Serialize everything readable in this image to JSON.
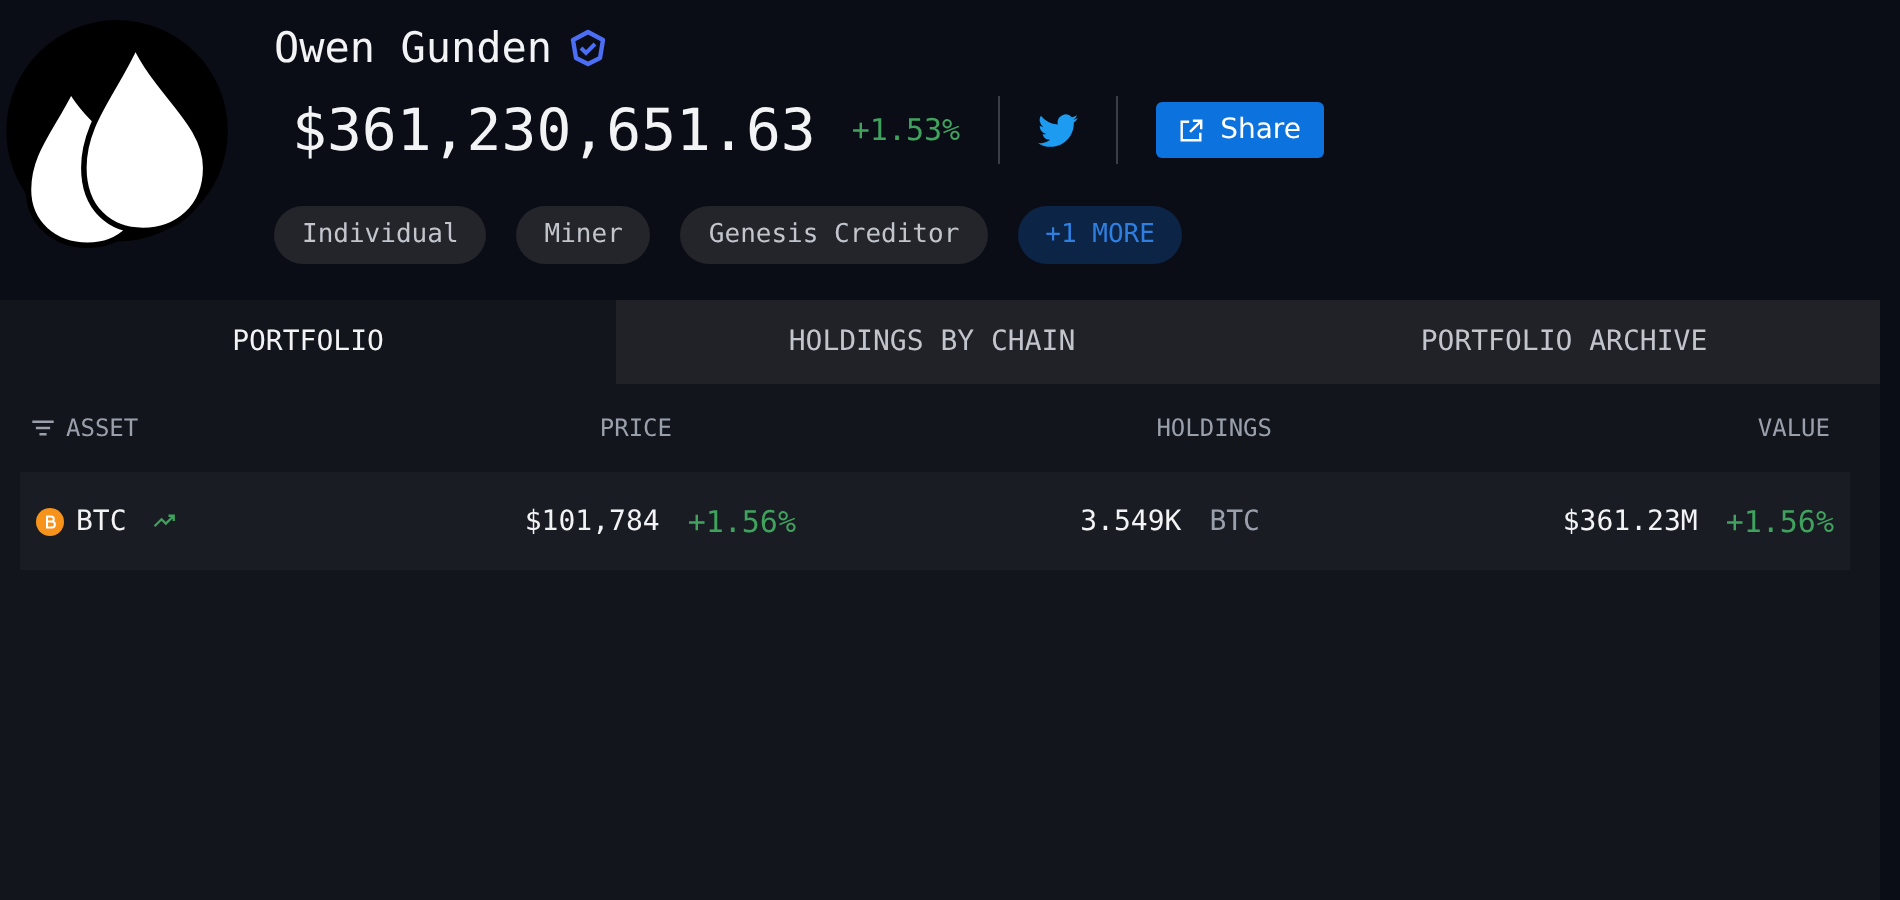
{
  "profile": {
    "name": "Owen Gunden",
    "verified": true,
    "balance": "$361,230,651.63",
    "change": "+1.53%",
    "share_label": "Share",
    "tags": [
      {
        "label": "Individual",
        "kind": "tag"
      },
      {
        "label": "Miner",
        "kind": "tag"
      },
      {
        "label": "Genesis Creditor",
        "kind": "tag"
      },
      {
        "label": "+1 MORE",
        "kind": "more"
      }
    ]
  },
  "tabs": [
    {
      "label": "PORTFOLIO",
      "selected": true
    },
    {
      "label": "HOLDINGS BY CHAIN",
      "selected": false
    },
    {
      "label": "PORTFOLIO ARCHIVE",
      "selected": false
    }
  ],
  "table": {
    "columns": [
      "ASSET",
      "PRICE",
      "HOLDINGS",
      "VALUE"
    ],
    "rows": [
      {
        "asset": "BTC",
        "price": "$101,784",
        "price_change": "+1.56%",
        "holdings": "3.549K",
        "holdings_unit": "BTC",
        "value": "$361.23M",
        "value_change": "+1.56%"
      }
    ]
  }
}
